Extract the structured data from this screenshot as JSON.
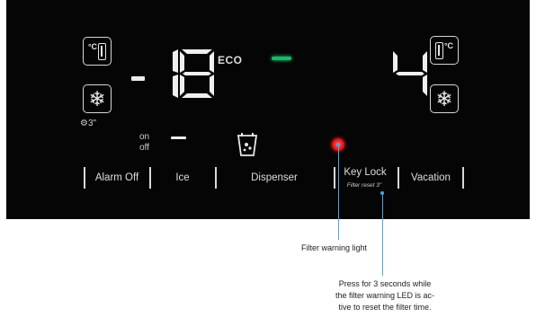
{
  "display": {
    "freezer_temp": "-18",
    "fridge_temp": "4",
    "eco_label": "ECO",
    "unit_symbol": "°C",
    "on_label": "on",
    "off_label": "off",
    "sub_icon_text": "3\""
  },
  "buttons": [
    {
      "label": "Alarm Off"
    },
    {
      "label": "Ice"
    },
    {
      "label": "Dispenser"
    },
    {
      "label": "Key Lock",
      "sublabel": "Filter reset 3\""
    },
    {
      "label": "Vacation"
    }
  ],
  "annotations": {
    "filter_light": "Filter warning light",
    "reset_line1": "Press for 3 seconds while",
    "reset_line2": "the filter warning LED is ac-",
    "reset_line3": "tive to reset the filter time."
  },
  "colors": {
    "panel": "#050505",
    "eco_indicator": "#19b86a",
    "filter_led": "#e01919",
    "callout": "#4aa8d8"
  },
  "icons": [
    "temperature-icon",
    "snowflake-icon",
    "dispenser-icon",
    "filter-warning-led"
  ]
}
